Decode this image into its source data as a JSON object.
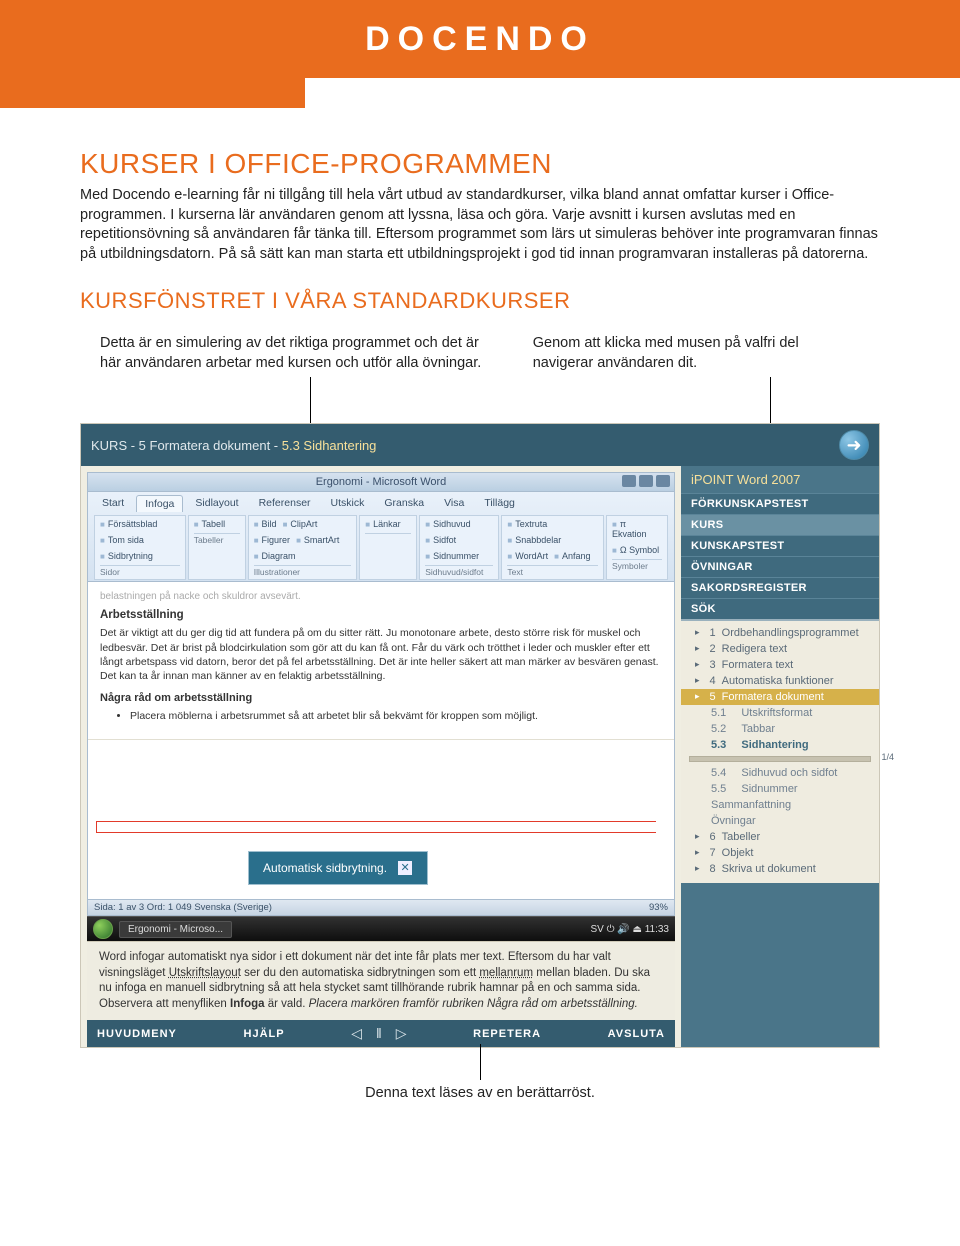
{
  "brand": "DOCENDO",
  "section_title": "KURSER I OFFICE-PROGRAMMEN",
  "body_text": "Med Docendo e-learning får ni tillgång till hela vårt utbud av standardkurser, vilka bland annat omfattar kurser i Office-programmen. I kurserna lär användaren genom att lyssna, läsa och göra. Varje avsnitt i kursen avslutas med en repetitionsövning så användaren får tänka till. Eftersom programmet som lärs ut simuleras behöver inte programvaran finnas på utbildningsdatorn. På så sätt kan man starta ett utbildningsprojekt i god tid innan programvaran installeras på datorerna.",
  "sub_title": "KURSFÖNSTRET I VÅRA STANDARDKURSER",
  "callout_left": "Detta är en simulering av det riktiga programmet och det är här användaren arbetar med kursen och utför alla övningar.",
  "callout_right": "Genom att klicka med musen på valfri del navigerar användaren dit.",
  "callout_bottom": "Denna text läses av en berättarröst.",
  "app": {
    "breadcrumb_prefix": "KURS - 5 Formatera dokument - ",
    "breadcrumb_current": "5.3 Sidhantering",
    "forward_arrow": "➜",
    "word_title": "Ergonomi - Microsoft Word",
    "tabs": [
      "Start",
      "Infoga",
      "Sidlayout",
      "Referenser",
      "Utskick",
      "Granska",
      "Visa",
      "Tillägg"
    ],
    "active_tab": "Infoga",
    "groups": {
      "sidor": {
        "items": [
          "Försättsblad",
          "Tom sida",
          "Sidbrytning"
        ],
        "label": "Sidor"
      },
      "tabeller": {
        "items": [
          "Tabell"
        ],
        "label": "Tabeller"
      },
      "illustrationer": {
        "items": [
          "Bild",
          "ClipArt",
          "Figurer",
          "SmartArt",
          "Diagram"
        ],
        "label": "Illustrationer"
      },
      "lankar": {
        "items": [
          "Länkar"
        ],
        "label": ""
      },
      "sidhuvud": {
        "items": [
          "Sidhuvud",
          "Sidfot",
          "Sidnummer"
        ],
        "label": "Sidhuvud/sidfot"
      },
      "text": {
        "items": [
          "Textruta",
          "Snabbdelar",
          "WordArt",
          "Anfang"
        ],
        "label": "Text"
      },
      "symboler": {
        "items": [
          "π Ekvation",
          "Ω Symbol"
        ],
        "label": "Symboler"
      }
    },
    "doc": {
      "faded_line": "belastningen på nacke och skuldror avsevärt.",
      "h1": "Arbetsställning",
      "p1": "Det är viktigt att du ger dig tid att fundera på om du sitter rätt. Ju monotonare arbete, desto större risk för muskel och ledbesvär. Det är brist på blodcirkulation som gör att du kan få ont. Får du värk och trötthet i leder och muskler efter ett långt arbetspass vid datorn, beror det på fel arbetsställning. Det är inte heller säkert att man märker av besvären genast. Det kan ta år innan man känner av en felaktig arbetsställning.",
      "h2": "Några råd om arbetsställning",
      "bullet": "Placera möblerna i arbetsrummet så att arbetet blir så bekvämt för kroppen som möjligt.",
      "pill": "Automatisk sidbrytning."
    },
    "status": {
      "left": "Sida: 1 av 3    Ord: 1 049    Svenska (Sverige)",
      "right": "93%"
    },
    "taskbar": {
      "app": "Ergonomi - Microso...",
      "tray": "SV  ⏻ 🔊 ⏏ 11:33"
    },
    "instruction": {
      "text_a": "Word infogar automatiskt nya sidor i ett dokument när det inte får plats mer text. Eftersom du har valt visningsläget ",
      "u1": "Utskriftslayout",
      "text_b": " ser du den automatiska sidbrytningen som ett ",
      "u2": "mellanrum",
      "text_c": " mellan bladen. Du ska nu infoga en manuell sidbrytning så att hela stycket samt tillhörande rubrik hamnar på en och samma sida. Observera att menyfliken ",
      "b1": "Infoga",
      "text_d": " är vald. ",
      "em": "Placera markören framför rubriken Några råd om arbetsställning."
    },
    "footer": {
      "huvudmeny": "HUVUDMENY",
      "hjalp": "HJÄLP",
      "repetera": "REPETERA",
      "avsluta": "AVSLUTA"
    },
    "sidebar": {
      "brand": "iPOINT Word 2007",
      "menu": [
        "FÖRKUNSKAPSTEST",
        "KURS",
        "KUNSKAPSTEST",
        "ÖVNINGAR",
        "SAKORDSREGISTER",
        "SÖK"
      ],
      "active_menu": "KURS",
      "nav": [
        {
          "n": "1",
          "t": "Ordbehandlingsprogrammet"
        },
        {
          "n": "2",
          "t": "Redigera text"
        },
        {
          "n": "3",
          "t": "Formatera text"
        },
        {
          "n": "4",
          "t": "Automatiska funktioner"
        },
        {
          "n": "5",
          "t": "Formatera dokument",
          "active": true
        }
      ],
      "sub": [
        {
          "n": "5.1",
          "t": "Utskriftsformat"
        },
        {
          "n": "5.2",
          "t": "Tabbar"
        },
        {
          "n": "5.3",
          "t": "Sidhantering",
          "sel": true
        }
      ],
      "after": [
        {
          "n": "5.4",
          "t": "Sidhuvud och sidfot"
        },
        {
          "n": "5.5",
          "t": "Sidnummer"
        },
        {
          "n": "",
          "t": "Sammanfattning"
        },
        {
          "n": "",
          "t": "Övningar"
        },
        {
          "n": "6",
          "t": "Tabeller"
        },
        {
          "n": "7",
          "t": "Objekt"
        },
        {
          "n": "8",
          "t": "Skriva ut dokument"
        }
      ]
    }
  }
}
